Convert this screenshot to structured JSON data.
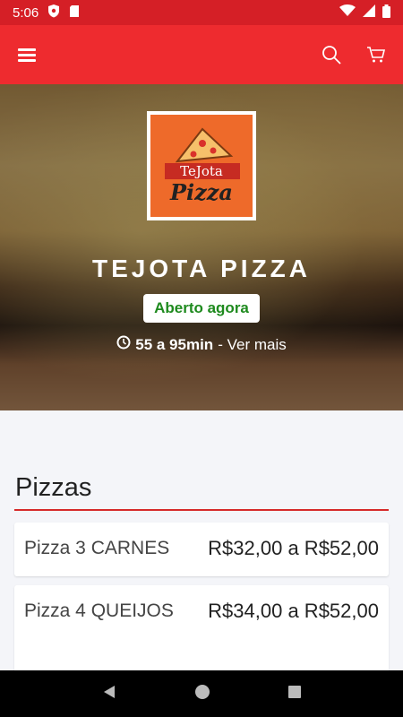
{
  "status_bar": {
    "time": "5:06"
  },
  "store": {
    "name": "TEJOTA PIZZA",
    "status": "Aberto agora",
    "delivery_time": "55 a 95min",
    "more_link": "- Ver mais",
    "logo_text_top": "TeJota",
    "logo_text_bottom": "Pizza"
  },
  "section": {
    "title": "Pizzas"
  },
  "items": [
    {
      "name": "Pizza 3 CARNES",
      "price": "R$32,00 a R$52,00"
    },
    {
      "name": "Pizza 4 QUEIJOS",
      "price": "R$34,00 a R$52,00"
    }
  ],
  "colors": {
    "brand_red": "#ee2b2f",
    "status_green": "#1e8a1e"
  }
}
